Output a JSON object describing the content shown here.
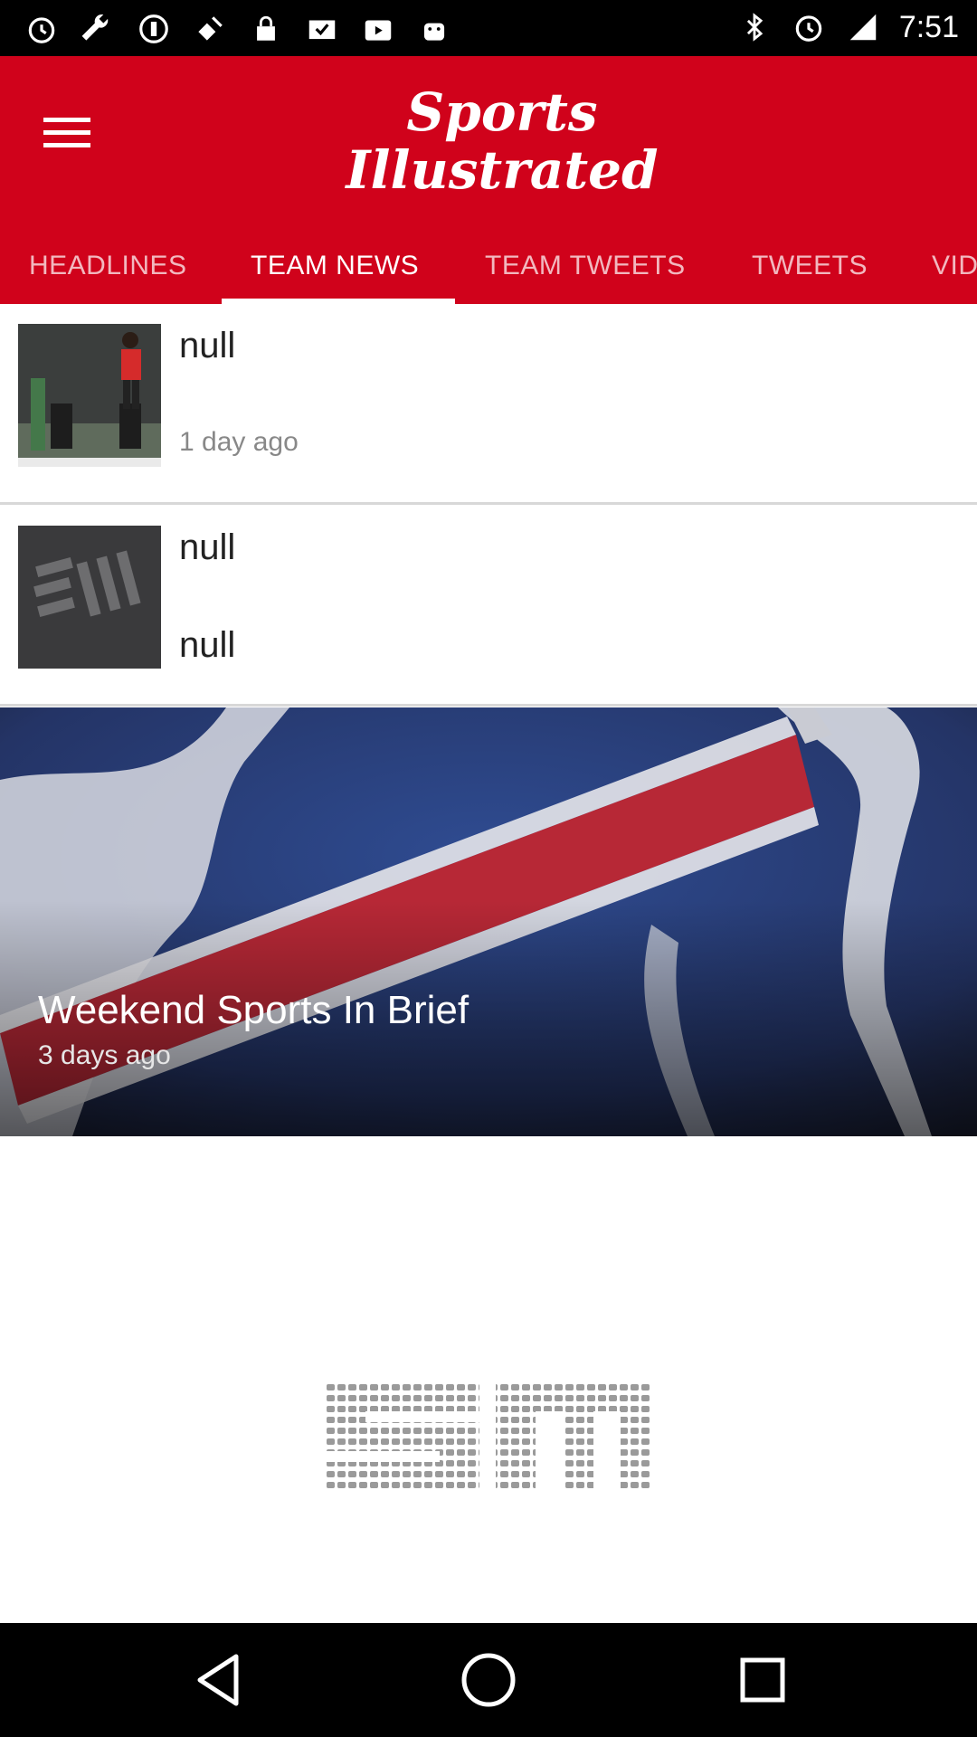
{
  "status_bar": {
    "time": "7:51",
    "left_icons": [
      "alarm-icon",
      "wrench-icon",
      "sync-icon",
      "fake-gps-icon",
      "lock-icon",
      "mail-check-icon",
      "play-store-icon",
      "android-icon"
    ],
    "right_icons": [
      "bluetooth-icon",
      "alarm-icon",
      "signal-icon"
    ]
  },
  "app_bar": {
    "logo_line1": "Sports",
    "logo_line2": "Illustrated",
    "accent_color": "#d0021b"
  },
  "tabs": [
    {
      "label": "HEADLINES",
      "active": false
    },
    {
      "label": "TEAM NEWS",
      "active": true
    },
    {
      "label": "TEAM TWEETS",
      "active": false
    },
    {
      "label": "TWEETS",
      "active": false
    },
    {
      "label": "VID",
      "active": false
    }
  ],
  "articles": [
    {
      "title": "null",
      "subtitle": "1 day ago"
    },
    {
      "title": "null",
      "subtitle": "null"
    }
  ],
  "hero": {
    "title": "Weekend Sports In Brief",
    "subtitle": "3 days ago"
  },
  "bottom_logo": "SI",
  "nav": {
    "icons": [
      "back-icon",
      "home-icon",
      "recents-icon"
    ]
  }
}
